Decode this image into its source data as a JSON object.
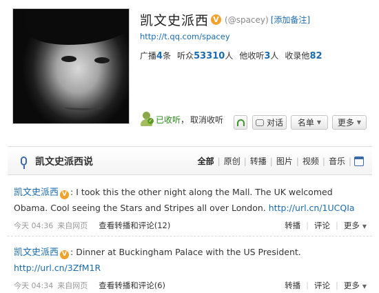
{
  "profile": {
    "name": "凯文史派西",
    "handle": "(@spacey)",
    "remark": "[添加备注]",
    "url": "http://t.qq.com/spacey",
    "stats": [
      {
        "label": "广播",
        "value": "4",
        "unit": "条"
      },
      {
        "label": "听众",
        "value": "53310",
        "unit": "人"
      },
      {
        "label": "他收听",
        "value": "3",
        "unit": "人"
      },
      {
        "label": "收录他",
        "value": "82",
        "unit": ""
      }
    ],
    "listened_label": "已收听",
    "sep": "，",
    "unfollow_label": "取消收听",
    "chat_label": "对话",
    "list_label": "名单",
    "more_label": "更多",
    "caret": "▼",
    "verified_icon": "V"
  },
  "timeline": {
    "title": "凯文史派西说",
    "tabs": [
      "全部",
      "原创",
      "转播",
      "图片",
      "视频",
      "音乐"
    ],
    "active_tab": 0,
    "sep": "|"
  },
  "posts": [
    {
      "author": "凯文史派西",
      "text": "I took this the other night along the Mall. The UK welcomed Obama. Cool seeing the Stars and Stripes all over London.",
      "link": "http://url.cn/1UCQIa",
      "time": "今天 04:36",
      "source": "来自网页",
      "view_label": "查看转播和评论",
      "count": "(12)",
      "actions": [
        "转播",
        "评论",
        "更多"
      ]
    },
    {
      "author": "凯文史派西",
      "text": "Dinner at Buckingham Palace with the US President.",
      "link": "http://url.cn/3ZfM1R",
      "time": "今天 04:34",
      "source": "来自网页",
      "view_label": "查看转播和评论",
      "count": "(6)",
      "actions": [
        "转播",
        "评论",
        "更多"
      ]
    }
  ],
  "colors": {
    "link": "#1a6bb0",
    "verified": "#f2a12b",
    "listened": "#2a8a1a"
  }
}
